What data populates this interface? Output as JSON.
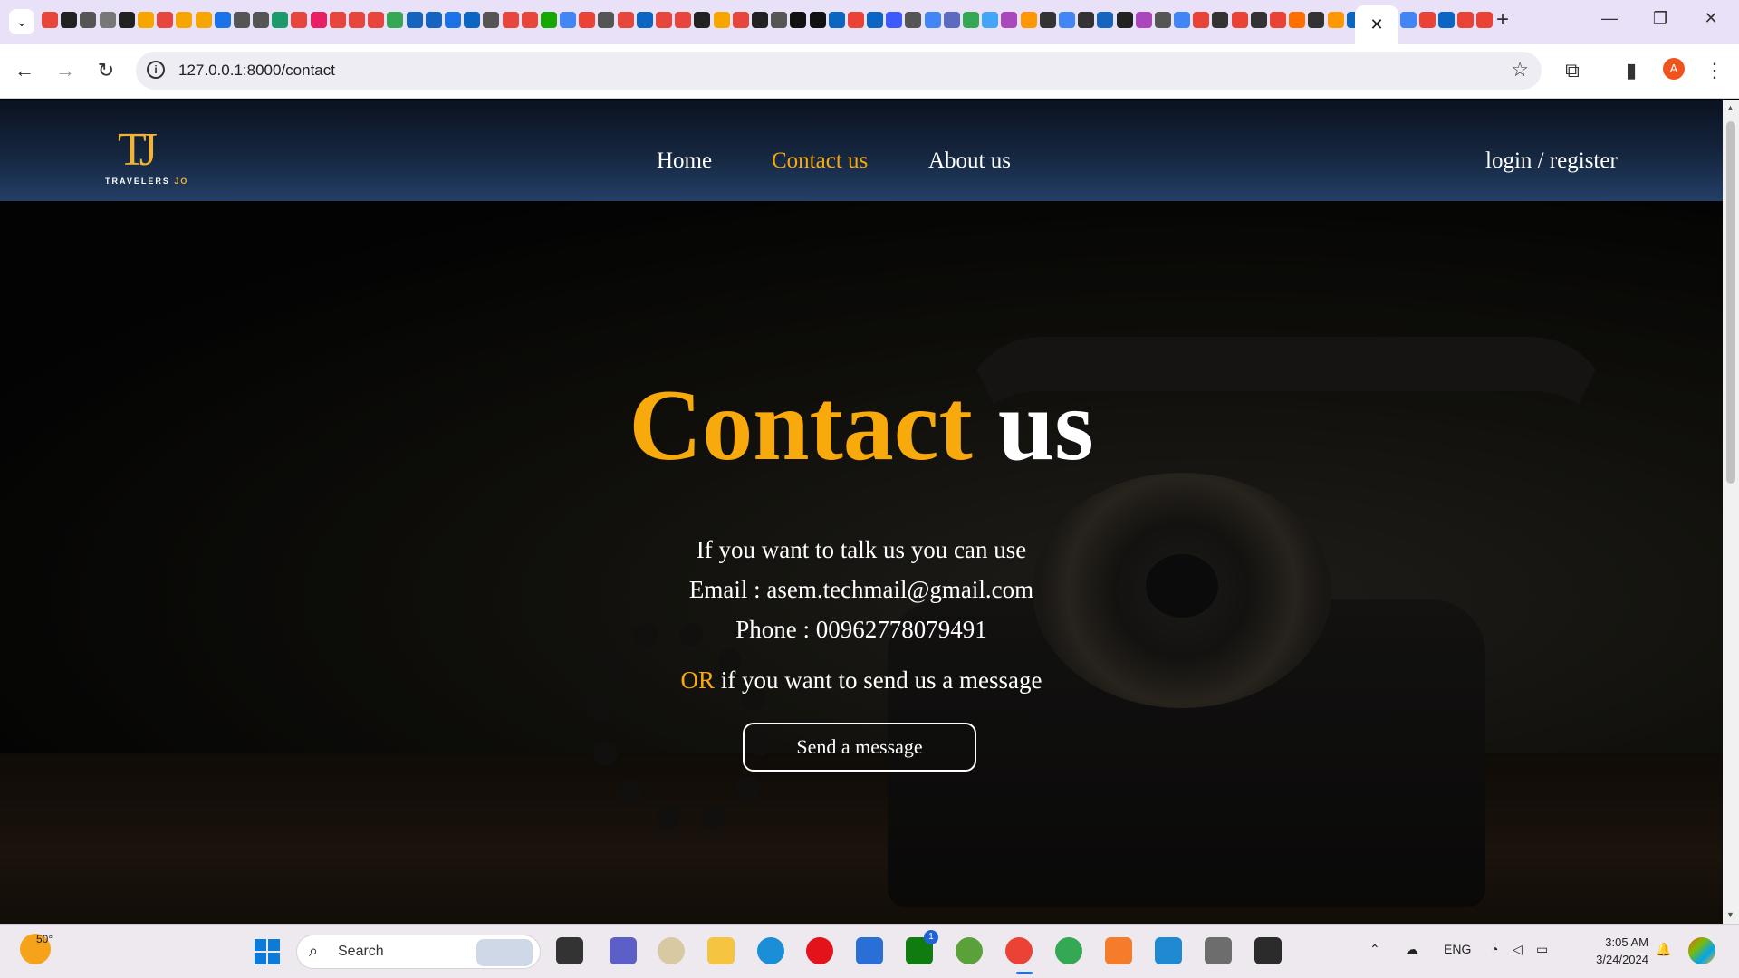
{
  "browser": {
    "url": "127.0.0.1:8000/contact",
    "tab_close": "✕",
    "new_tab": "+",
    "profile_initial": "A",
    "tab_favicon_colors": [
      "#e8453c",
      "#222222",
      "#555555",
      "#777777",
      "#222222",
      "#f7a600",
      "#e8453c",
      "#f7a600",
      "#f7a600",
      "#1a73e8",
      "#555555",
      "#555555",
      "#1c9a6c",
      "#e8453c",
      "#e91e63",
      "#e8453c",
      "#e8453c",
      "#e8453c",
      "#34a853",
      "#1565c0",
      "#1565c0",
      "#1a73e8",
      "#0a66c2",
      "#555555",
      "#e8453c",
      "#e8453c",
      "#14a800",
      "#4285f4",
      "#ea4335",
      "#555555",
      "#e8453c",
      "#0a66c2",
      "#e8453c",
      "#e8453c",
      "#222222",
      "#f7a600",
      "#e8453c",
      "#222222",
      "#555555",
      "#111111",
      "#111111",
      "#0a66c2",
      "#ea4335",
      "#0a66c2",
      "#3d5afe",
      "#555555",
      "#4285f4",
      "#5c6bc0",
      "#34a853",
      "#42a5f5",
      "#ab47bc",
      "#ff9800",
      "#333333",
      "#4285f4",
      "#333333",
      "#1565c0",
      "#222222",
      "#ab47bc",
      "#555555",
      "#4285f4",
      "#ea4335",
      "#333333",
      "#ea4335",
      "#333333",
      "#ea4335",
      "#ff6f00",
      "#333333",
      "#ff9800",
      "#0a66c2",
      "#555555",
      "#4285f4"
    ],
    "tab_favicon_colors_right": [
      "#4285f4",
      "#ea4335",
      "#0a66c2",
      "#ea4335",
      "#ea4335"
    ]
  },
  "site": {
    "logo_letters": "TJ",
    "logo_word_1": "TRAVELERS",
    "logo_word_2": "JO",
    "nav": {
      "home": "Home",
      "contact": "Contact us",
      "about": "About us",
      "auth": "login / register"
    }
  },
  "hero": {
    "title_accent": "Contact",
    "title_rest": "us",
    "intro": "If you want to talk us you can use",
    "email": "Email : asem.techmail@gmail.com",
    "phone": "Phone : 00962778079491",
    "or": "OR",
    "message_prompt": "if you want to send us a message",
    "button": "Send a message"
  },
  "taskbar": {
    "temperature": "50°",
    "search_label": "Search",
    "language": "ENG",
    "time": "3:05 AM",
    "date": "3/24/2024",
    "xbox_badge": "1"
  },
  "colors": {
    "accent": "#f8a90b",
    "header_top": "#0b1220",
    "header_bottom": "#243f66"
  }
}
